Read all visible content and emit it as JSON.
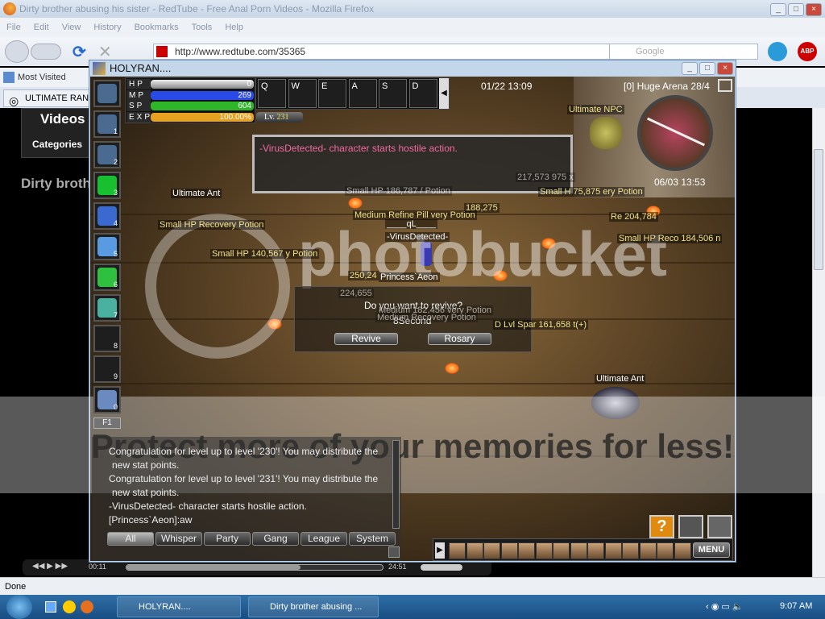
{
  "browser": {
    "title": "Dirty brother abusing his sister - RedTube - Free Anal Porn Videos - Mozilla Firefox",
    "menu": [
      "File",
      "Edit",
      "View",
      "History",
      "Bookmarks",
      "Tools",
      "Help"
    ],
    "url": "http://www.redtube.com/35365",
    "search_placeholder": "Google",
    "bookmarks": [
      "Most Visited"
    ],
    "tab": "ULTIMATE RAN",
    "page": {
      "heading": "Videos",
      "categories": "Categories",
      "video_title": "Dirty broth"
    },
    "video": {
      "current": "00:11",
      "total": "24:51",
      "progress": 0.01,
      "buffered": 0.68
    },
    "status": "Done"
  },
  "game": {
    "window_title": "HOLYRAN....",
    "stats": [
      {
        "label": "HP",
        "value": "0",
        "fill": 0,
        "color": "#bbbbbb"
      },
      {
        "label": "MP",
        "value": "269",
        "fill": 1,
        "color": "#2a4ae8"
      },
      {
        "label": "SP",
        "value": "604",
        "fill": 1,
        "color": "#2fb52a"
      },
      {
        "label": "EXP",
        "value": "100.00%",
        "fill": 1,
        "color": "#e8a020"
      }
    ],
    "level_prefix": "Lv.",
    "level": "231",
    "hotkeys": [
      "Q",
      "W",
      "E",
      "A",
      "S",
      "D"
    ],
    "skill_slots": [
      "",
      "1",
      "2",
      "3",
      "4",
      "5",
      "6",
      "7",
      "8",
      "9",
      "0"
    ],
    "f_key": "F1",
    "date_time": "01/22 13:09",
    "map": "[0] Huge Arena 28/4",
    "minimap_time": "06/03 13:53",
    "system_message": "-VirusDetected- character starts hostile action.",
    "labels": [
      "Ultimate NPC",
      "Ultimate Ant",
      "Small HP Recovery Potion",
      "Small HP 140,567 y Potion",
      "Small HP 186,787 / Potion",
      "Medium Refine Pill very Potion",
      "188,275",
      "____qL____",
      "-VirusDetected-",
      "217,573 975 x",
      "Small H 75,875 ery Potion",
      "Re 204,784",
      "Small HP Reco 184,506 n",
      "250,24",
      "Princess`Aeon",
      "224,655",
      "Medium 182,456 very Potion",
      "Medium Recovery Potion",
      "D Lvl Spar 161,658 t(+)",
      "Ultimate Ant"
    ],
    "revive": {
      "question": "Do you want to revive?",
      "countdown": "8Second",
      "revive": "Revive",
      "rosary": "Rosary"
    },
    "chat": {
      "lines": [
        "Congratulation for level up to level '230'! You may distribute the",
        " new stat points.",
        "Congratulation for level up to level '231'! You may distribute the",
        " new stat points.",
        "-VirusDetected- character starts hostile action.",
        "[Princess`Aeon]:aw"
      ],
      "tabs": [
        "All",
        "Whisper",
        "Party",
        "Gang",
        "League",
        "System"
      ]
    },
    "menu_button": "MENU"
  },
  "taskbar": {
    "items": [
      "HOLYRAN....",
      "Dirty brother abusing ..."
    ],
    "clock": "9:07 AM"
  },
  "watermark": {
    "logo": "photobucket",
    "slogan": "Protect more of your memories for less!"
  }
}
